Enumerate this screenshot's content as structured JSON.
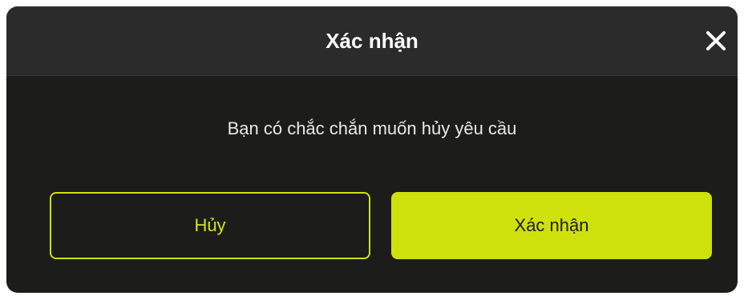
{
  "dialog": {
    "title": "Xác nhận",
    "close_icon": "close-icon",
    "message": "Bạn có chắc chắn muốn hủy yêu cầu",
    "cancel_label": "Hủy",
    "confirm_label": "Xác nhận"
  },
  "colors": {
    "accent": "#cfe10d",
    "dialog_background": "#1c1d1a",
    "header_background": "#2b2b2b"
  }
}
